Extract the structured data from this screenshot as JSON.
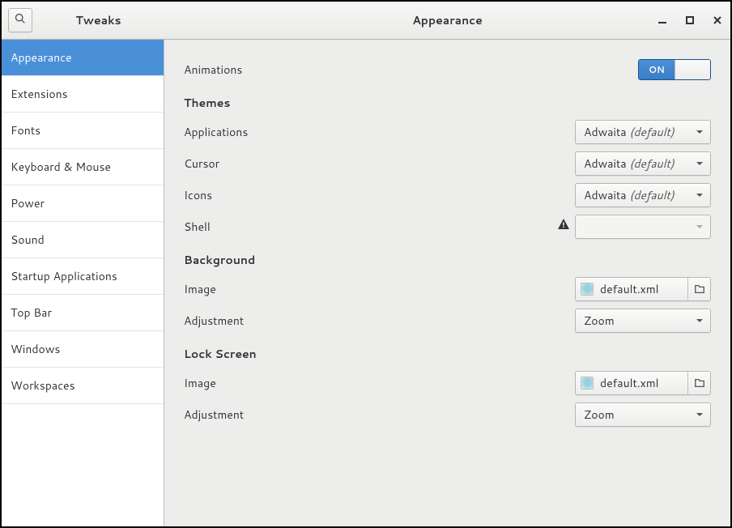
{
  "header": {
    "app_title": "Tweaks",
    "page_title": "Appearance"
  },
  "sidebar": {
    "items": [
      {
        "label": "Appearance",
        "selected": true
      },
      {
        "label": "Extensions",
        "selected": false
      },
      {
        "label": "Fonts",
        "selected": false
      },
      {
        "label": "Keyboard & Mouse",
        "selected": false
      },
      {
        "label": "Power",
        "selected": false
      },
      {
        "label": "Sound",
        "selected": false
      },
      {
        "label": "Startup Applications",
        "selected": false
      },
      {
        "label": "Top Bar",
        "selected": false
      },
      {
        "label": "Windows",
        "selected": false
      },
      {
        "label": "Workspaces",
        "selected": false
      }
    ]
  },
  "main": {
    "animations": {
      "label": "Animations",
      "switch_on": "ON",
      "value": true
    },
    "themes": {
      "header": "Themes",
      "applications": {
        "label": "Applications",
        "value": "Adwaita",
        "default_suffix": "(default)"
      },
      "cursor": {
        "label": "Cursor",
        "value": "Adwaita",
        "default_suffix": "(default)"
      },
      "icons": {
        "label": "Icons",
        "value": "Adwaita",
        "default_suffix": "(default)"
      },
      "shell": {
        "label": "Shell",
        "value": "",
        "disabled": true,
        "warning": true
      }
    },
    "background": {
      "header": "Background",
      "image": {
        "label": "Image",
        "filename": "default.xml"
      },
      "adjustment": {
        "label": "Adjustment",
        "value": "Zoom"
      }
    },
    "lockscreen": {
      "header": "Lock Screen",
      "image": {
        "label": "Image",
        "filename": "default.xml"
      },
      "adjustment": {
        "label": "Adjustment",
        "value": "Zoom"
      }
    }
  }
}
